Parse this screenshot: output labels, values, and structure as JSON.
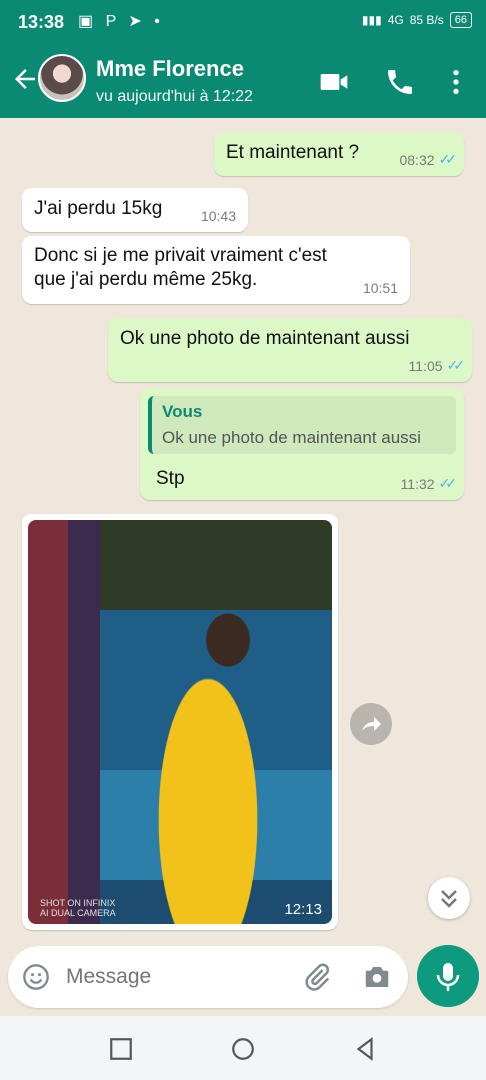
{
  "status_bar": {
    "time": "13:38",
    "right_small": "4G",
    "speed": "85 B/s",
    "battery": "66"
  },
  "header": {
    "title": "Mme Florence",
    "subtitle": "vu aujourd'hui à 12:22"
  },
  "messages": [
    {
      "type": "outgoing",
      "text": "Et maintenant ?",
      "time": "08:32"
    },
    {
      "type": "incoming",
      "text": "J'ai perdu 15kg",
      "time": "10:43"
    },
    {
      "type": "incoming",
      "text_line1": "Donc si je me privait vraiment c'est",
      "text_line2": "que j'ai perdu même 25kg.",
      "time": "10:51"
    },
    {
      "type": "outgoing",
      "text": "Ok une photo de maintenant aussi",
      "time": "11:05"
    },
    {
      "type": "outgoing_reply",
      "reply_name": "Vous",
      "reply_text": "Ok une photo de maintenant aussi",
      "text": "Stp",
      "time": "11:32"
    },
    {
      "type": "incoming_photo",
      "time": "12:13",
      "caption_line1": "SHOT ON INFINIX",
      "caption_line2": "AI DUAL CAMERA"
    }
  ],
  "composer": {
    "placeholder": "Message"
  },
  "colors": {
    "header": "#0b8a73",
    "outgoing": "#dcf8c6",
    "incoming": "#ffffff",
    "ticks": "#4fb6ec",
    "mic": "#0d9b7e"
  },
  "icons": [
    "back-arrow-icon",
    "video-call-icon",
    "phone-icon",
    "more-vert-icon",
    "emoji-icon",
    "attach-icon",
    "camera-icon",
    "mic-icon",
    "forward-icon",
    "chevron-down-icon"
  ]
}
